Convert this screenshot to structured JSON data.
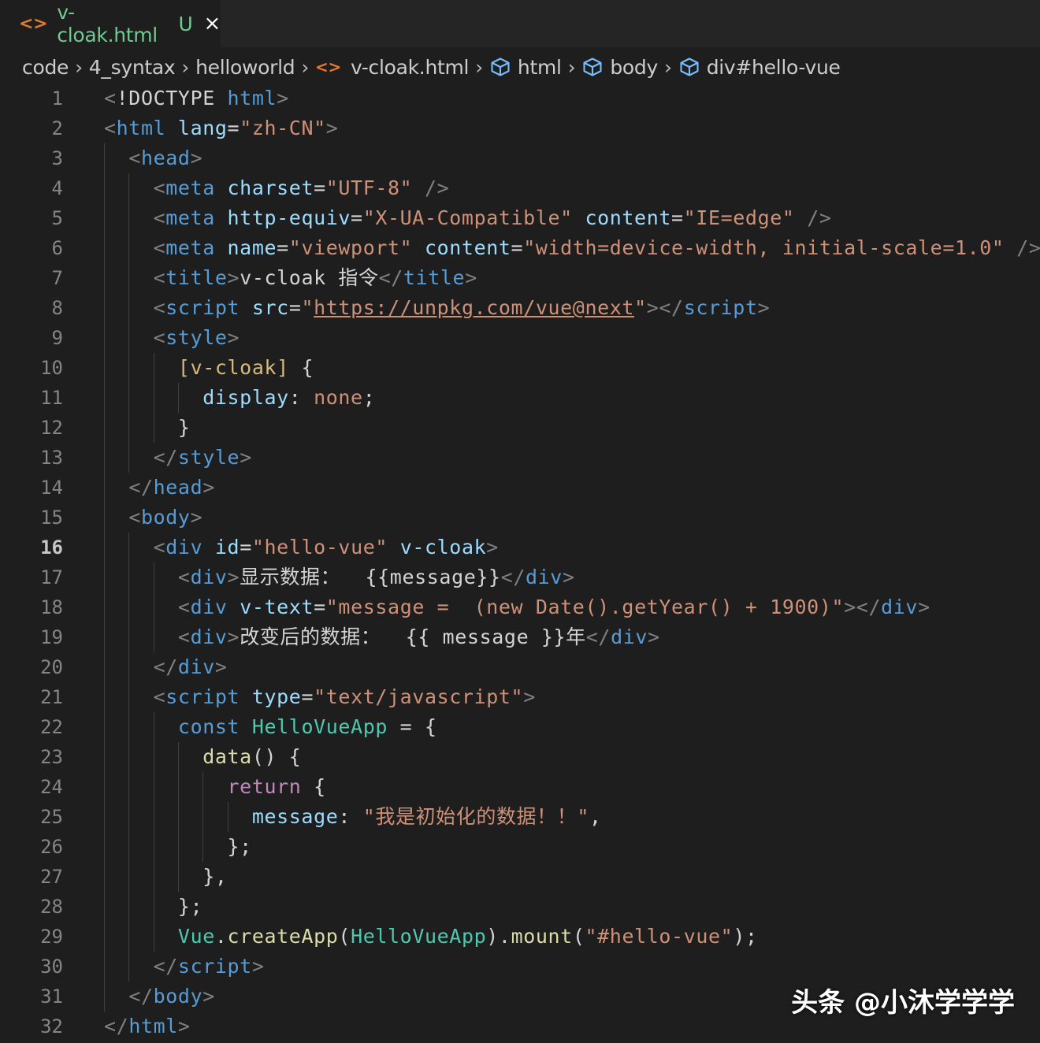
{
  "tab": {
    "icon": "file-code-icon",
    "filename": "v-cloak.html",
    "status": "U",
    "close": "×"
  },
  "breadcrumb": [
    {
      "label": "code",
      "icon": ""
    },
    {
      "label": "4_syntax",
      "icon": ""
    },
    {
      "label": "helloworld",
      "icon": ""
    },
    {
      "label": "v-cloak.html",
      "icon": "file-code-icon"
    },
    {
      "label": "html",
      "icon": "symbol-box-icon"
    },
    {
      "label": "body",
      "icon": "symbol-box-icon"
    },
    {
      "label": "div#hello-vue",
      "icon": "symbol-box-icon"
    }
  ],
  "editor": {
    "active_line": 16,
    "lines": [
      [
        [
          "punc",
          "<"
        ],
        [
          "text",
          "!DOCTYPE "
        ],
        [
          "tag",
          "html"
        ],
        [
          "punc",
          ">"
        ]
      ],
      [
        [
          "punc",
          "<"
        ],
        [
          "tag",
          "html"
        ],
        [
          "text",
          " "
        ],
        [
          "attr",
          "lang"
        ],
        [
          "text",
          "="
        ],
        [
          "str",
          "\"zh-CN\""
        ],
        [
          "punc",
          ">"
        ]
      ],
      [
        [
          "text",
          "  "
        ],
        [
          "punc",
          "<"
        ],
        [
          "tag",
          "head"
        ],
        [
          "punc",
          ">"
        ]
      ],
      [
        [
          "text",
          "    "
        ],
        [
          "punc",
          "<"
        ],
        [
          "tag",
          "meta"
        ],
        [
          "text",
          " "
        ],
        [
          "attr",
          "charset"
        ],
        [
          "text",
          "="
        ],
        [
          "str",
          "\"UTF-8\""
        ],
        [
          "text",
          " "
        ],
        [
          "punc",
          "/>"
        ]
      ],
      [
        [
          "text",
          "    "
        ],
        [
          "punc",
          "<"
        ],
        [
          "tag",
          "meta"
        ],
        [
          "text",
          " "
        ],
        [
          "attr",
          "http-equiv"
        ],
        [
          "text",
          "="
        ],
        [
          "str",
          "\"X-UA-Compatible\""
        ],
        [
          "text",
          " "
        ],
        [
          "attr",
          "content"
        ],
        [
          "text",
          "="
        ],
        [
          "str",
          "\"IE=edge\""
        ],
        [
          "text",
          " "
        ],
        [
          "punc",
          "/>"
        ]
      ],
      [
        [
          "text",
          "    "
        ],
        [
          "punc",
          "<"
        ],
        [
          "tag",
          "meta"
        ],
        [
          "text",
          " "
        ],
        [
          "attr",
          "name"
        ],
        [
          "text",
          "="
        ],
        [
          "str",
          "\"viewport\""
        ],
        [
          "text",
          " "
        ],
        [
          "attr",
          "content"
        ],
        [
          "text",
          "="
        ],
        [
          "str",
          "\"width=device-width, initial-scale=1.0\""
        ],
        [
          "text",
          " "
        ],
        [
          "punc",
          "/>"
        ]
      ],
      [
        [
          "text",
          "    "
        ],
        [
          "punc",
          "<"
        ],
        [
          "tag",
          "title"
        ],
        [
          "punc",
          ">"
        ],
        [
          "text",
          "v-cloak 指令"
        ],
        [
          "punc",
          "</"
        ],
        [
          "tag",
          "title"
        ],
        [
          "punc",
          ">"
        ]
      ],
      [
        [
          "text",
          "    "
        ],
        [
          "punc",
          "<"
        ],
        [
          "tag",
          "script"
        ],
        [
          "text",
          " "
        ],
        [
          "attr",
          "src"
        ],
        [
          "text",
          "="
        ],
        [
          "str",
          "\""
        ],
        [
          "link",
          "https://unpkg.com/vue@next"
        ],
        [
          "str",
          "\""
        ],
        [
          "punc",
          "></"
        ],
        [
          "tag",
          "script"
        ],
        [
          "punc",
          ">"
        ]
      ],
      [
        [
          "text",
          "    "
        ],
        [
          "punc",
          "<"
        ],
        [
          "tag",
          "style"
        ],
        [
          "punc",
          ">"
        ]
      ],
      [
        [
          "text",
          "      "
        ],
        [
          "sel",
          "[v-cloak]"
        ],
        [
          "text",
          " {"
        ]
      ],
      [
        [
          "text",
          "        "
        ],
        [
          "prop",
          "display"
        ],
        [
          "text",
          ": "
        ],
        [
          "cssval",
          "none"
        ],
        [
          "text",
          ";"
        ]
      ],
      [
        [
          "text",
          "      "
        ],
        [
          "text",
          "}"
        ]
      ],
      [
        [
          "text",
          "    "
        ],
        [
          "punc",
          "</"
        ],
        [
          "tag",
          "style"
        ],
        [
          "punc",
          ">"
        ]
      ],
      [
        [
          "text",
          "  "
        ],
        [
          "punc",
          "</"
        ],
        [
          "tag",
          "head"
        ],
        [
          "punc",
          ">"
        ]
      ],
      [
        [
          "text",
          "  "
        ],
        [
          "punc",
          "<"
        ],
        [
          "tag",
          "body"
        ],
        [
          "punc",
          ">"
        ]
      ],
      [
        [
          "text",
          "    "
        ],
        [
          "punc",
          "<"
        ],
        [
          "tag",
          "div"
        ],
        [
          "text",
          " "
        ],
        [
          "attr",
          "id"
        ],
        [
          "text",
          "="
        ],
        [
          "str",
          "\"hello-vue\""
        ],
        [
          "text",
          " "
        ],
        [
          "attr",
          "v-cloak"
        ],
        [
          "punc",
          ">"
        ]
      ],
      [
        [
          "text",
          "      "
        ],
        [
          "punc",
          "<"
        ],
        [
          "tag",
          "div"
        ],
        [
          "punc",
          ">"
        ],
        [
          "text",
          "显示数据：  {{message}}"
        ],
        [
          "punc",
          "</"
        ],
        [
          "tag",
          "div"
        ],
        [
          "punc",
          ">"
        ]
      ],
      [
        [
          "text",
          "      "
        ],
        [
          "punc",
          "<"
        ],
        [
          "tag",
          "div"
        ],
        [
          "text",
          " "
        ],
        [
          "attr",
          "v-text"
        ],
        [
          "text",
          "="
        ],
        [
          "str",
          "\"message =  (new Date().getYear() + 1900)\""
        ],
        [
          "punc",
          "></"
        ],
        [
          "tag",
          "div"
        ],
        [
          "punc",
          ">"
        ]
      ],
      [
        [
          "text",
          "      "
        ],
        [
          "punc",
          "<"
        ],
        [
          "tag",
          "div"
        ],
        [
          "punc",
          ">"
        ],
        [
          "text",
          "改变后的数据：  {{ message }}年"
        ],
        [
          "punc",
          "</"
        ],
        [
          "tag",
          "div"
        ],
        [
          "punc",
          ">"
        ]
      ],
      [
        [
          "text",
          "    "
        ],
        [
          "punc",
          "</"
        ],
        [
          "tag",
          "div"
        ],
        [
          "punc",
          ">"
        ]
      ],
      [
        [
          "text",
          "    "
        ],
        [
          "punc",
          "<"
        ],
        [
          "tag",
          "script"
        ],
        [
          "text",
          " "
        ],
        [
          "attr",
          "type"
        ],
        [
          "text",
          "="
        ],
        [
          "str",
          "\"text/javascript\""
        ],
        [
          "punc",
          ">"
        ]
      ],
      [
        [
          "text",
          "      "
        ],
        [
          "kw",
          "const"
        ],
        [
          "text",
          " "
        ],
        [
          "cls",
          "HelloVueApp"
        ],
        [
          "text",
          " = {"
        ]
      ],
      [
        [
          "text",
          "        "
        ],
        [
          "fn",
          "data"
        ],
        [
          "text",
          "() {"
        ]
      ],
      [
        [
          "text",
          "          "
        ],
        [
          "ctrl",
          "return"
        ],
        [
          "text",
          " {"
        ]
      ],
      [
        [
          "text",
          "            "
        ],
        [
          "var",
          "message"
        ],
        [
          "text",
          ": "
        ],
        [
          "str",
          "\"我是初始化的数据！！\""
        ],
        [
          "text",
          ","
        ]
      ],
      [
        [
          "text",
          "          "
        ],
        [
          "text",
          "};"
        ]
      ],
      [
        [
          "text",
          "        "
        ],
        [
          "text",
          "},"
        ]
      ],
      [
        [
          "text",
          "      "
        ],
        [
          "text",
          "};"
        ]
      ],
      [
        [
          "text",
          "      "
        ],
        [
          "cls",
          "Vue"
        ],
        [
          "text",
          "."
        ],
        [
          "fn",
          "createApp"
        ],
        [
          "text",
          "("
        ],
        [
          "cls",
          "HelloVueApp"
        ],
        [
          "text",
          ")."
        ],
        [
          "fn",
          "mount"
        ],
        [
          "text",
          "("
        ],
        [
          "str",
          "\"#hello-vue\""
        ],
        [
          "text",
          ");"
        ]
      ],
      [
        [
          "text",
          "    "
        ],
        [
          "punc",
          "</"
        ],
        [
          "tag",
          "script"
        ],
        [
          "punc",
          ">"
        ]
      ],
      [
        [
          "text",
          "  "
        ],
        [
          "punc",
          "</"
        ],
        [
          "tag",
          "body"
        ],
        [
          "punc",
          ">"
        ]
      ],
      [
        [
          "punc",
          "</"
        ],
        [
          "tag",
          "html"
        ],
        [
          "punc",
          ">"
        ]
      ]
    ]
  },
  "watermark": "头条 @小沐学学学"
}
